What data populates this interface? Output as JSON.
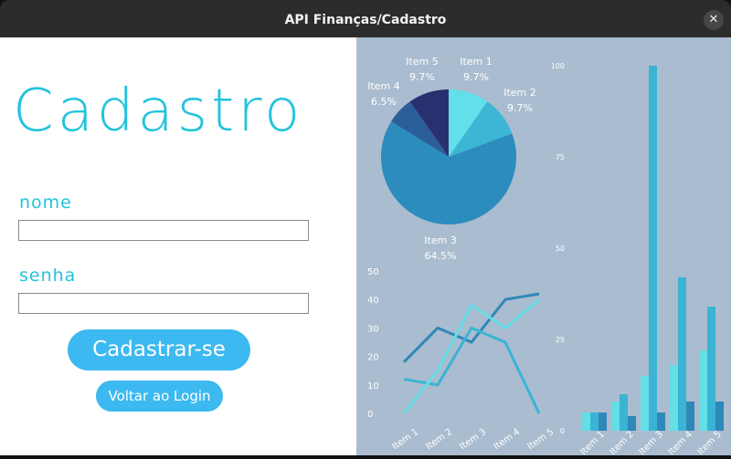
{
  "window": {
    "title": "API Finanças/Cadastro",
    "close_glyph": "✕"
  },
  "form": {
    "heading": "Cadastro",
    "nome_label": "nome",
    "nome_value": "",
    "senha_label": "senha",
    "senha_value": "",
    "submit_label": "Cadastrar-se",
    "back_label": "Voltar ao Login"
  },
  "colors": {
    "accent": "#22c3dd",
    "button": "#3cb9f0",
    "chart_bg": "#aabccf"
  },
  "chart_data": [
    {
      "type": "pie",
      "categories": [
        "Item 1",
        "Item 2",
        "Item 3",
        "Item 4",
        "Item 5"
      ],
      "values": [
        9.7,
        9.7,
        64.5,
        6.5,
        9.7
      ],
      "labels": [
        "9.7%",
        "9.7%",
        "64.5%",
        "6.5%",
        "9.7%"
      ],
      "colors": [
        "#62dfe8",
        "#3db6d6",
        "#2d8cbe",
        "#2a5f9a",
        "#283070"
      ]
    },
    {
      "type": "line",
      "categories": [
        "Item 1",
        "Item 2",
        "Item 3",
        "Item 4",
        "Item 5"
      ],
      "ylim": [
        0,
        50
      ],
      "yticks": [
        0,
        10,
        20,
        30,
        40,
        50
      ],
      "series": [
        {
          "values": [
            18,
            30,
            25,
            40,
            42
          ],
          "color": "#2e88b8"
        },
        {
          "values": [
            12,
            10,
            30,
            25,
            0
          ],
          "color": "#3ab4d4"
        },
        {
          "values": [
            0,
            15,
            38,
            30,
            40
          ],
          "color": "#64dfe6"
        }
      ]
    },
    {
      "type": "bar",
      "categories": [
        "Item 1",
        "Item 2",
        "Item 3",
        "Item 4",
        "Item 5"
      ],
      "ylim": [
        0,
        100
      ],
      "yticks": [
        0,
        25,
        50,
        75,
        100
      ],
      "series": [
        {
          "values": [
            5,
            8,
            15,
            18,
            22
          ],
          "color": "#64dfe6"
        },
        {
          "values": [
            5,
            10,
            100,
            42,
            34
          ],
          "color": "#3ab4d4"
        },
        {
          "values": [
            5,
            4,
            5,
            8,
            8
          ],
          "color": "#2e88b8"
        }
      ]
    }
  ]
}
